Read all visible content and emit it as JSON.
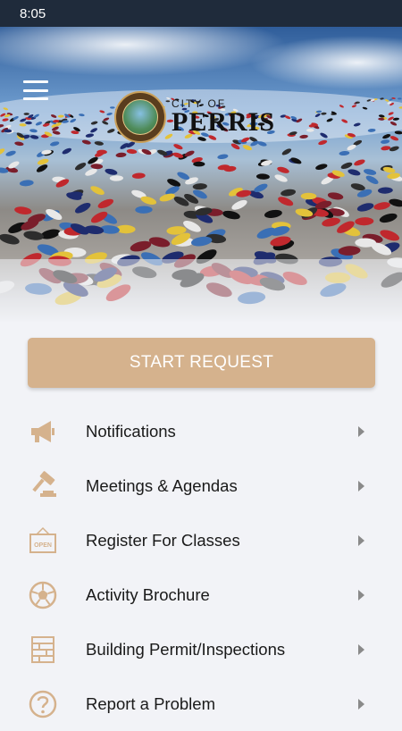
{
  "status_bar": {
    "time": "8:05"
  },
  "header": {
    "menu_icon": "hamburger-menu-icon",
    "logo": {
      "city_of": "CITY OF",
      "name": "PERRIS",
      "seal_text": "City of Perris Inc. 1911"
    },
    "background": "skydivers-formation-photo"
  },
  "primary_action": {
    "label": "START REQUEST",
    "color": "#d5b28d"
  },
  "menu": [
    {
      "label": "Notifications",
      "icon": "megaphone-icon"
    },
    {
      "label": "Meetings & Agendas",
      "icon": "gavel-icon"
    },
    {
      "label": "Register For Classes",
      "icon": "open-sign-icon",
      "icon_text": "OPEN"
    },
    {
      "label": "Activity Brochure",
      "icon": "soccer-ball-icon"
    },
    {
      "label": "Building Permit/Inspections",
      "icon": "building-plan-icon"
    },
    {
      "label": "Report a Problem",
      "icon": "question-circle-icon"
    }
  ],
  "colors": {
    "accent": "#d5b28d",
    "status_bar": "#1f2b3b",
    "background": "#f2f3f7"
  }
}
